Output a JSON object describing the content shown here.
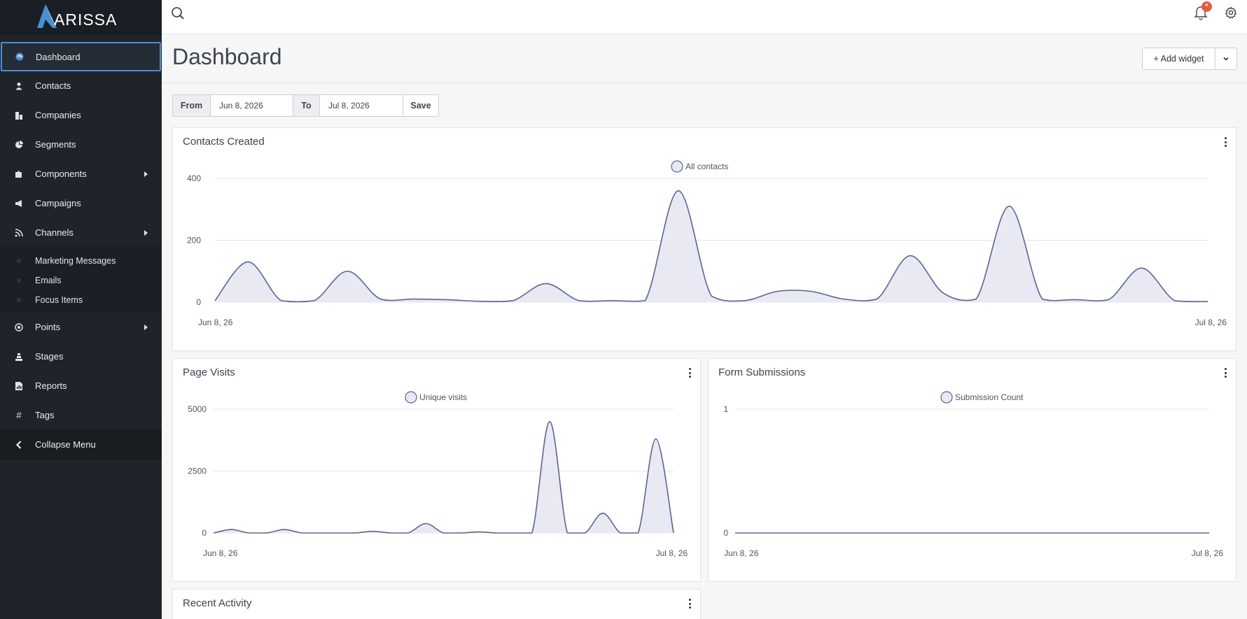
{
  "brand": {
    "logo_text": "ARISSA"
  },
  "sidebar": {
    "items": [
      {
        "label": "Dashboard",
        "icon": "dashboard-icon"
      },
      {
        "label": "Contacts",
        "icon": "user-icon"
      },
      {
        "label": "Companies",
        "icon": "building-icon"
      },
      {
        "label": "Segments",
        "icon": "pie-icon"
      },
      {
        "label": "Components",
        "icon": "puzzle-icon"
      },
      {
        "label": "Campaigns",
        "icon": "megaphone-icon"
      },
      {
        "label": "Channels",
        "icon": "rss-icon"
      },
      {
        "label": "Points",
        "icon": "target-icon"
      },
      {
        "label": "Stages",
        "icon": "stages-icon"
      },
      {
        "label": "Reports",
        "icon": "report-icon"
      },
      {
        "label": "Tags",
        "icon": "hash-icon"
      },
      {
        "label": "Collapse Menu",
        "icon": "chevron-left-icon"
      }
    ],
    "channels_sub": [
      "Marketing Messages",
      "Emails",
      "Focus Items"
    ]
  },
  "header": {
    "title": "Dashboard",
    "add_widget": "+ Add widget"
  },
  "topbar": {
    "badge": "*"
  },
  "datefilter": {
    "from_label": "From",
    "from_value": "Jun 8, 2026",
    "to_label": "To",
    "to_value": "Jul 8, 2026",
    "save": "Save"
  },
  "widgets": {
    "contacts": {
      "title": "Contacts Created"
    },
    "pages": {
      "title": "Page Visits"
    },
    "forms": {
      "title": "Form Submissions"
    },
    "recent": {
      "title": "Recent Activity"
    }
  },
  "colors": {
    "line": "#5b6494",
    "fill": "#e8e9f3",
    "accent": "#4c8fd4"
  },
  "chart_data": [
    {
      "type": "area",
      "title": "Contacts Created",
      "series": [
        {
          "name": "All contacts",
          "values": [
            5,
            130,
            5,
            5,
            100,
            10,
            10,
            8,
            3,
            5,
            60,
            5,
            5,
            5,
            360,
            20,
            5,
            35,
            35,
            10,
            10,
            150,
            30,
            10,
            310,
            10,
            8,
            8,
            110,
            5,
            2
          ]
        }
      ],
      "x_tick_labels": [
        "Jun 8, 26",
        "Jul 8, 26"
      ],
      "y_ticks": [
        0,
        200,
        400
      ],
      "ylim": [
        0,
        400
      ],
      "legend": "top-center",
      "grid": true
    },
    {
      "type": "area",
      "title": "Page Visits",
      "series": [
        {
          "name": "Unique visits",
          "values": [
            0,
            140,
            0,
            0,
            140,
            0,
            0,
            0,
            0,
            70,
            0,
            0,
            380,
            0,
            0,
            40,
            0,
            0,
            0,
            4500,
            0,
            0,
            800,
            0,
            0,
            3800,
            0
          ]
        }
      ],
      "x_tick_labels": [
        "Jun 8, 26",
        "Jul 8, 26"
      ],
      "y_ticks": [
        0,
        2500,
        5000
      ],
      "ylim": [
        0,
        5000
      ],
      "legend": "top-center",
      "grid": true
    },
    {
      "type": "line",
      "title": "Form Submissions",
      "series": [
        {
          "name": "Submission Count",
          "values": [
            0,
            0,
            0,
            0,
            0,
            0,
            0,
            0,
            0,
            0,
            0,
            0,
            0,
            0,
            0,
            0,
            0,
            0,
            0,
            0,
            0,
            0,
            0,
            0,
            0,
            0,
            0,
            0,
            0,
            0,
            0
          ]
        }
      ],
      "x_tick_labels": [
        "Jun 8, 26",
        "Jul 8, 26"
      ],
      "y_ticks": [
        0,
        1
      ],
      "ylim": [
        0,
        1
      ],
      "legend": "top-center",
      "grid": true
    }
  ]
}
